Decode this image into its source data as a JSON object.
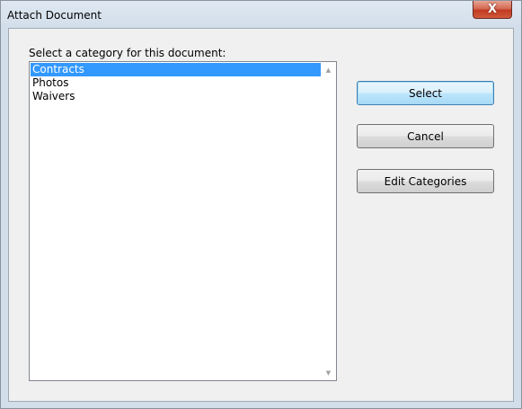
{
  "window": {
    "title": "Attach Document",
    "close_glyph": "X"
  },
  "dialog": {
    "prompt": "Select a category for this document:",
    "categories": [
      {
        "label": "Contracts",
        "selected": true
      },
      {
        "label": "Photos",
        "selected": false
      },
      {
        "label": "Waivers",
        "selected": false
      }
    ],
    "scroll_up_glyph": "▲",
    "scroll_down_glyph": "▼"
  },
  "buttons": {
    "select_label": "Select",
    "cancel_label": "Cancel",
    "edit_categories_label": "Edit Categories"
  },
  "colors": {
    "selection": "#3399ff",
    "default_button_border": "#3c7fb1",
    "close_button": "#c23a22"
  }
}
